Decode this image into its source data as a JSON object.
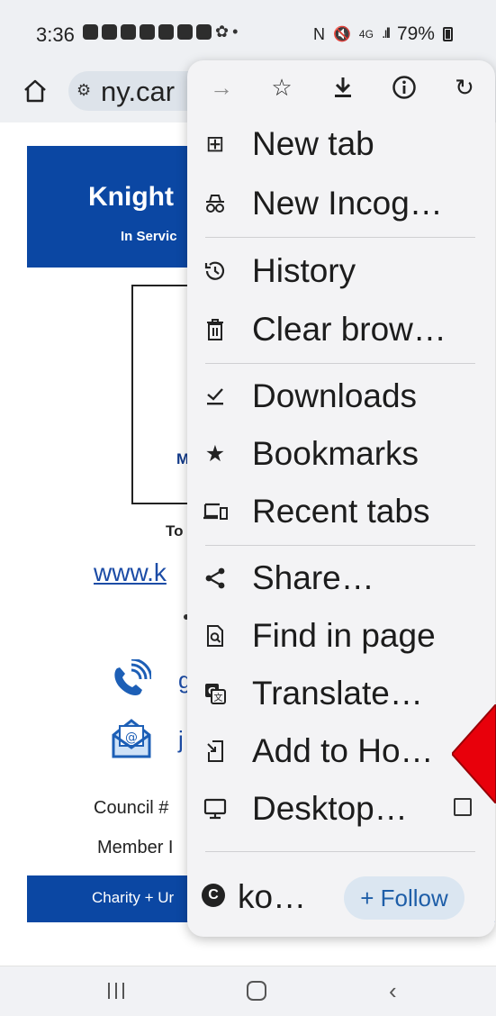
{
  "status_bar": {
    "time": "3:36",
    "network": "4G",
    "battery": "79%"
  },
  "address_bar": {
    "url_fragment": "ny.car"
  },
  "page": {
    "banner_title": "Knight",
    "banner_subtitle": "In Servic",
    "image_letter": "M",
    "to_text": "To",
    "website_link": "www.k",
    "phone_fragment": "g",
    "email_fragment": "j",
    "council_text": "Council #",
    "member_text": "Member I",
    "charity_bar": "Charity + Ur"
  },
  "menu": {
    "items": [
      {
        "label": "New tab",
        "icon": "new-tab-icon"
      },
      {
        "label": "New Incog…",
        "icon": "incognito-icon"
      },
      {
        "label": "History",
        "icon": "history-icon"
      },
      {
        "label": "Clear brow…",
        "icon": "trash-icon"
      },
      {
        "label": "Downloads",
        "icon": "downloads-check-icon"
      },
      {
        "label": "Bookmarks",
        "icon": "star-filled-icon"
      },
      {
        "label": "Recent tabs",
        "icon": "devices-icon"
      },
      {
        "label": "Share…",
        "icon": "share-icon"
      },
      {
        "label": "Find in page",
        "icon": "find-in-page-icon"
      },
      {
        "label": "Translate…",
        "icon": "translate-icon"
      },
      {
        "label": "Add to Ho…",
        "icon": "add-to-home-icon"
      },
      {
        "label": "Desktop…",
        "icon": "desktop-icon"
      }
    ],
    "follow": {
      "site_label": "ko…",
      "button_label": "+ Follow"
    }
  },
  "colors": {
    "brand_blue": "#0b47a3",
    "annotation_arrow": "#e8000b"
  }
}
